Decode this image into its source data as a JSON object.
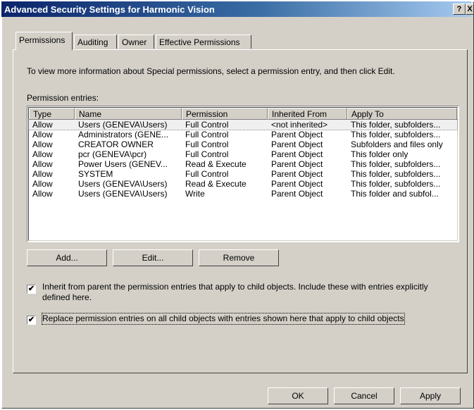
{
  "window": {
    "title": "Advanced Security Settings for Harmonic Vision",
    "help_glyph": "?",
    "close_glyph": "X"
  },
  "tabs": [
    {
      "label": "Permissions",
      "active": true
    },
    {
      "label": "Auditing",
      "active": false
    },
    {
      "label": "Owner",
      "active": false
    },
    {
      "label": "Effective Permissions",
      "active": false
    }
  ],
  "permissions": {
    "info_text": "To view more information about Special permissions, select a permission entry, and then click Edit.",
    "entries_label": "Permission entries:",
    "columns": [
      "Type",
      "Name",
      "Permission",
      "Inherited From",
      "Apply To"
    ],
    "rows": [
      [
        "Allow",
        "Users (GENEVA\\Users)",
        "Full Control",
        "<not inherited>",
        "This folder, subfolders..."
      ],
      [
        "Allow",
        "Administrators (GENE...",
        "Full Control",
        "Parent Object",
        "This folder, subfolders..."
      ],
      [
        "Allow",
        "CREATOR OWNER",
        "Full Control",
        "Parent Object",
        "Subfolders and files only"
      ],
      [
        "Allow",
        "pcr (GENEVA\\pcr)",
        "Full Control",
        "Parent Object",
        "This folder only"
      ],
      [
        "Allow",
        "Power Users (GENEV...",
        "Read & Execute",
        "Parent Object",
        "This folder, subfolders..."
      ],
      [
        "Allow",
        "SYSTEM",
        "Full Control",
        "Parent Object",
        "This folder, subfolders..."
      ],
      [
        "Allow",
        "Users (GENEVA\\Users)",
        "Read & Execute",
        "Parent Object",
        "This folder, subfolders..."
      ],
      [
        "Allow",
        "Users (GENEVA\\Users)",
        "Write",
        "Parent Object",
        "This folder and subfol..."
      ]
    ],
    "buttons": {
      "add": "Add...",
      "edit": "Edit...",
      "remove": "Remove"
    },
    "inherit_checkbox": {
      "checked": true,
      "line1": "Inherit from parent the permission entries that apply to child objects. Include these with entries explicitly",
      "line2": "defined here."
    },
    "replace_checkbox": {
      "checked": true,
      "label": "Replace permission entries on all child objects with entries shown here that apply to child objects"
    }
  },
  "dialog_buttons": {
    "ok": "OK",
    "cancel": "Cancel",
    "apply": "Apply"
  },
  "check_glyph": "✔"
}
